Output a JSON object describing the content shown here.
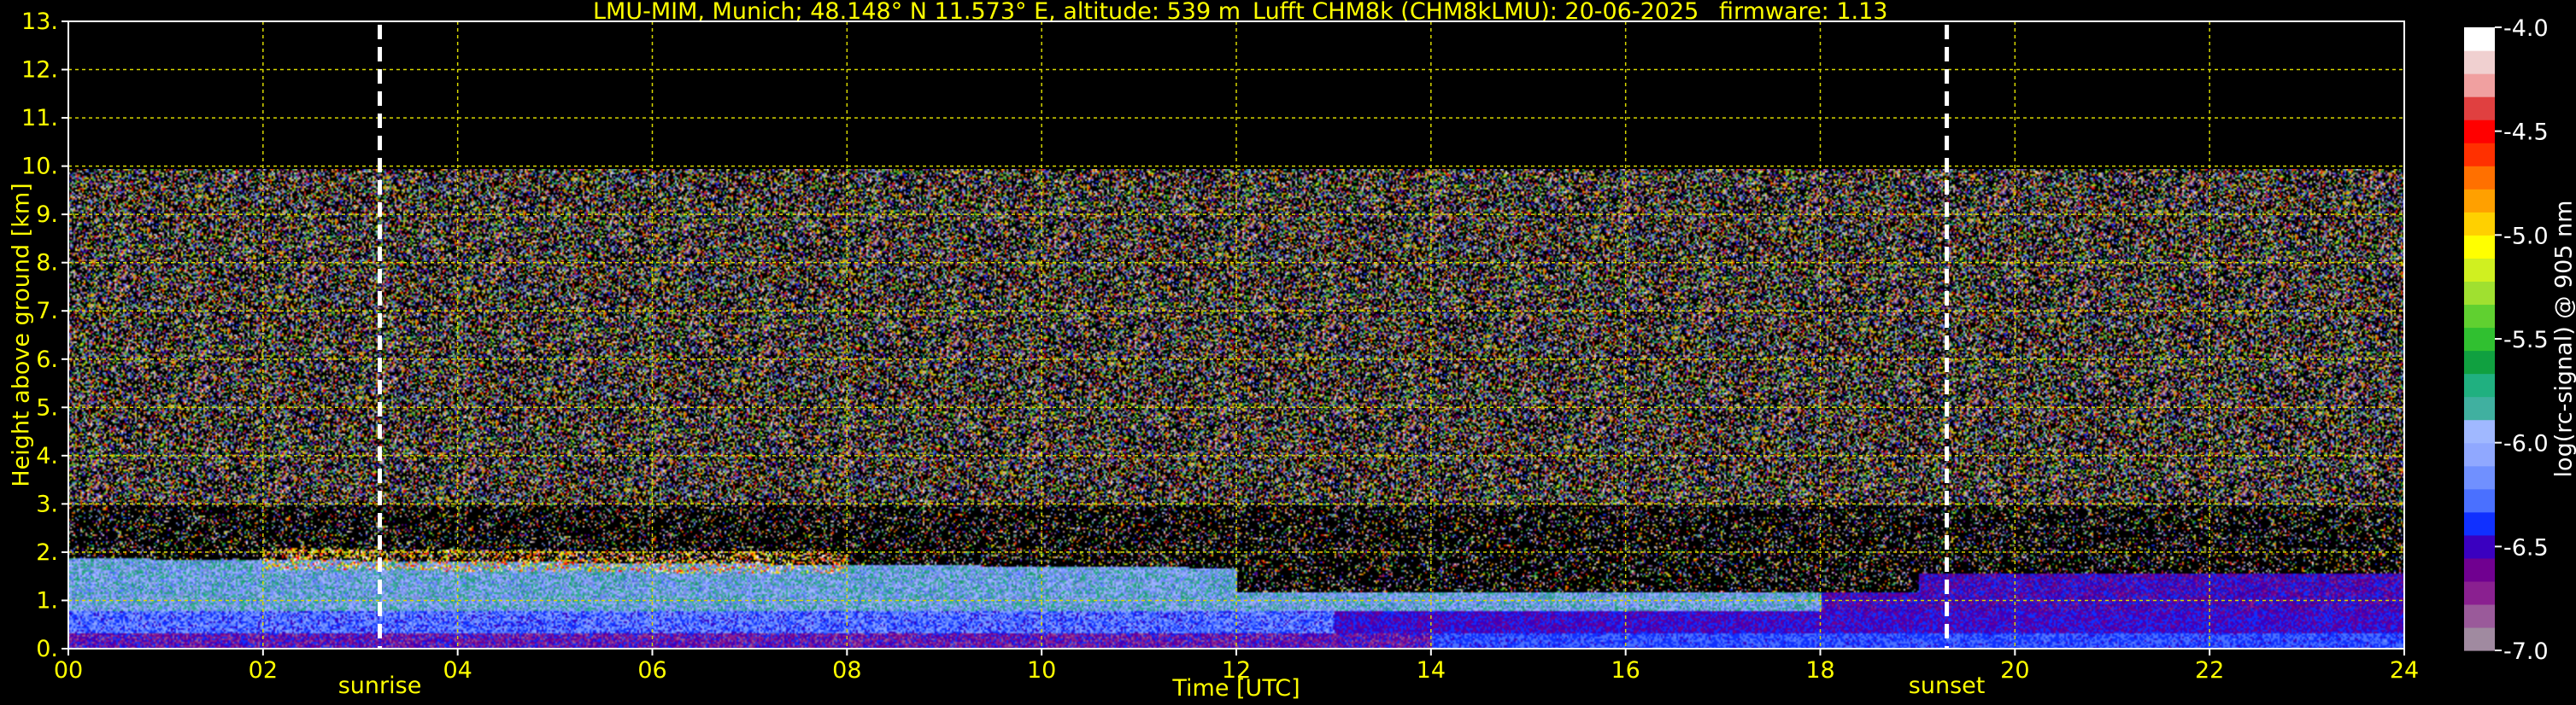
{
  "header": {
    "title": "LMU-MIM, Munich; 48.148° N 11.573° E, altitude: 539 m",
    "instrument": "Lufft CHM8k (CHM8kLMU): 20-06-2025",
    "firmware": "firmware: 1.13"
  },
  "chart_data": {
    "type": "heatmap",
    "xlabel": "Time [UTC]",
    "ylabel": "Height above ground [km]",
    "xlim": [
      0,
      24
    ],
    "ylim": [
      0,
      13
    ],
    "x_ticks": [
      "00",
      "02",
      "04",
      "06",
      "08",
      "10",
      "12",
      "14",
      "16",
      "18",
      "20",
      "22",
      "24"
    ],
    "y_ticks": [
      "0.",
      "1.",
      "2.",
      "3.",
      "4.",
      "5.",
      "6.",
      "7.",
      "8.",
      "9.",
      "10.",
      "11.",
      "12.",
      "13."
    ],
    "grid": true,
    "data_top_km": 10,
    "annotations": [
      {
        "label": "sunrise",
        "time": 3.2
      },
      {
        "label": "sunset",
        "time": 19.3
      }
    ],
    "layers": [
      {
        "name": "boundary layer",
        "top_km_start": 1.9,
        "top_km_end": 1.7
      },
      {
        "name": "cloud returns",
        "height_km": 1.8,
        "time_start": 2.0,
        "time_end": 8.0
      }
    ],
    "colorbar": {
      "label": "log(rc-signal) @ 905 nm",
      "range": [
        -7.0,
        -4.0
      ],
      "ticks": [
        "-4.0",
        "-4.5",
        "-5.0",
        "-5.5",
        "-6.0",
        "-6.5",
        "-7.0"
      ],
      "colors": [
        "#a08aa0",
        "#9a5a9a",
        "#8a2090",
        "#700090",
        "#3a00c0",
        "#1030ff",
        "#4a70ff",
        "#7090ff",
        "#90a8ff",
        "#a0b8ff",
        "#40b0a0",
        "#20b080",
        "#10a040",
        "#30c030",
        "#60d030",
        "#a0e030",
        "#d0f020",
        "#ffff00",
        "#ffd000",
        "#ffa000",
        "#ff7000",
        "#ff3000",
        "#ff0000",
        "#e04040",
        "#f0a0a0",
        "#f0d0d0",
        "#ffffff"
      ]
    }
  }
}
